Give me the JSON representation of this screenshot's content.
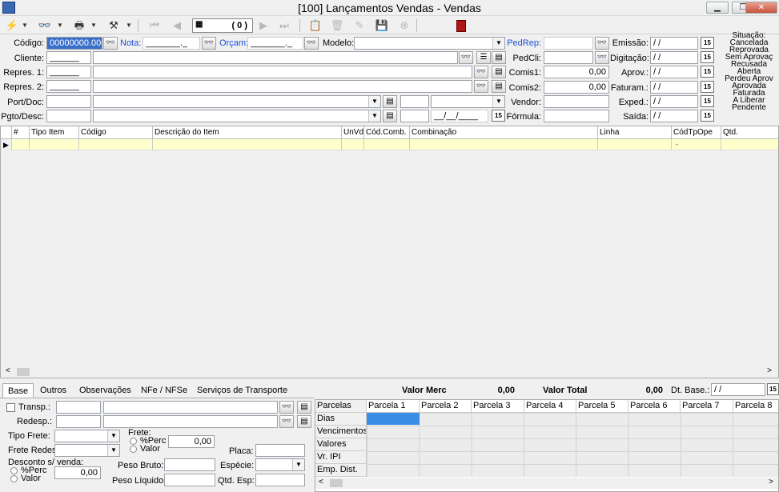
{
  "window": {
    "title": "[100] Lançamentos Vendas - Vendas",
    "min": "▁",
    "max": "❐",
    "close": "✕"
  },
  "toolbar": {
    "counter": "( 0 )"
  },
  "header": {
    "codigo_label": "Código:",
    "codigo_value": "00000000.000",
    "nota_label": "Nota:",
    "nota_value": "_______._",
    "orcam_label": "Orçam:",
    "orcam_value": "_______._",
    "modelo_label": "Modelo:",
    "pedrep_label": "PedRep:",
    "pedcli_label": "PedCli:",
    "comis1_label": "Comis1:",
    "comis1_value": "0,00",
    "comis2_label": "Comis2:",
    "comis2_value": "0,00",
    "vendor_label": "Vendor:",
    "formula_label": "Fórmula:",
    "emissao_label": "Emissão:",
    "digitacao_label": "Digitação:",
    "aprov_label": "Aprov.:",
    "faturam_label": "Faturam.:",
    "exped_label": "Exped.:",
    "saida_label": "Saída:",
    "date_blank": "/ /",
    "cliente_label": "Cliente:",
    "cliente_value": "______",
    "repres1_label": "Repres. 1:",
    "repres1_value": "______",
    "repres2_label": "Repres. 2:",
    "repres2_value": "______",
    "portdoc_label": "Port/Doc:",
    "pgtodesc_label": "Pgto/Desc:",
    "pgto_date": "__/__/____"
  },
  "situacao": {
    "title": "Situação:",
    "items": [
      "Cancelada",
      "Reprovada",
      "Sem Aprovaç",
      "Recusada",
      "Aberta",
      "Perdeu Aprov",
      "Aprovada",
      "Faturada",
      "A Liberar",
      "Pendente"
    ]
  },
  "grid": {
    "columns": [
      "#",
      "Tipo Item",
      "Código",
      "Descrição do Item",
      "UnVd",
      "Cód.Comb.",
      "Combinação",
      "Linha",
      "CódTpOpe",
      "Qtd."
    ],
    "row_marker": "▶",
    "row_dot": "."
  },
  "bottom": {
    "tabs": [
      "Base",
      "Outros",
      "Observações",
      "NFe / NFSe",
      "Serviços de Transporte"
    ],
    "valor_merc_label": "Valor Merc",
    "valor_merc": "0,00",
    "valor_total_label": "Valor Total",
    "valor_total": "0,00",
    "dt_base_label": "Dt. Base.:",
    "dt_base_value": "/ /",
    "transp_label": "Transp.:",
    "redesp_label": "Redesp.:",
    "tipo_frete_label": "Tipo Frete:",
    "frete_redes_label": "Frete Redes",
    "frete_label": "Frete:",
    "perc": "%Perc",
    "valor": "Valor",
    "frete_value": "0,00",
    "desconto_label": "Desconto s/ venda:",
    "desconto_value": "0,00",
    "placa_label": "Placa:",
    "peso_bruto_label": "Peso Bruto:",
    "especie_label": "Espécie:",
    "peso_liquido_label": "Peso Líquido:",
    "qtd_esp_label": "Qtd. Esp:"
  },
  "parcelas": {
    "corner": "Parcelas",
    "headers": [
      "Parcela 1",
      "Parcela 2",
      "Parcela 3",
      "Parcela 4",
      "Parcela 5",
      "Parcela 6",
      "Parcela 7",
      "Parcela 8"
    ],
    "rows": [
      "Dias",
      "Vencimentos",
      "Valores",
      "Vr. IPI",
      "Emp. Dist."
    ]
  }
}
